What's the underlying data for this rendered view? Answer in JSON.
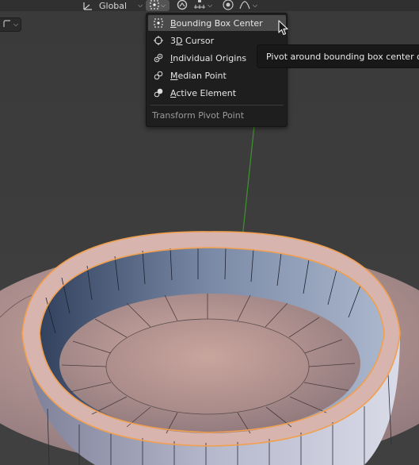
{
  "header": {
    "orientation_label": "Global",
    "icons": [
      "transform-orientation-icon",
      "pivot-point-icon",
      "snap-icon",
      "snap-target-icon",
      "proportional-editing-icon",
      "falloff-curve-icon"
    ]
  },
  "pivot_menu": {
    "title": "Transform Pivot Point",
    "items": [
      {
        "prefix": "",
        "underline": "B",
        "suffix": "ounding Box Center",
        "icon": "bounding-box-center-icon",
        "active": true
      },
      {
        "prefix": "3",
        "underline": "D",
        "suffix": " Cursor",
        "icon": "3d-cursor-icon",
        "active": false
      },
      {
        "prefix": "",
        "underline": "I",
        "suffix": "ndividual Origins",
        "icon": "individual-origins-icon",
        "active": false
      },
      {
        "prefix": "",
        "underline": "M",
        "suffix": "edian Point",
        "icon": "median-point-icon",
        "active": false
      },
      {
        "prefix": "",
        "underline": "A",
        "suffix": "ctive Element",
        "icon": "active-element-icon",
        "active": false
      }
    ]
  },
  "tooltip": {
    "text": "Pivot around bounding box center of se"
  },
  "colors": {
    "viewport_bg": "#3d3d3d",
    "menu_bg": "#1e1e1e",
    "menu_highlight": "#4a4a4a",
    "selection_edge": "#f0a050",
    "y_axis": "#3e8e2e"
  }
}
